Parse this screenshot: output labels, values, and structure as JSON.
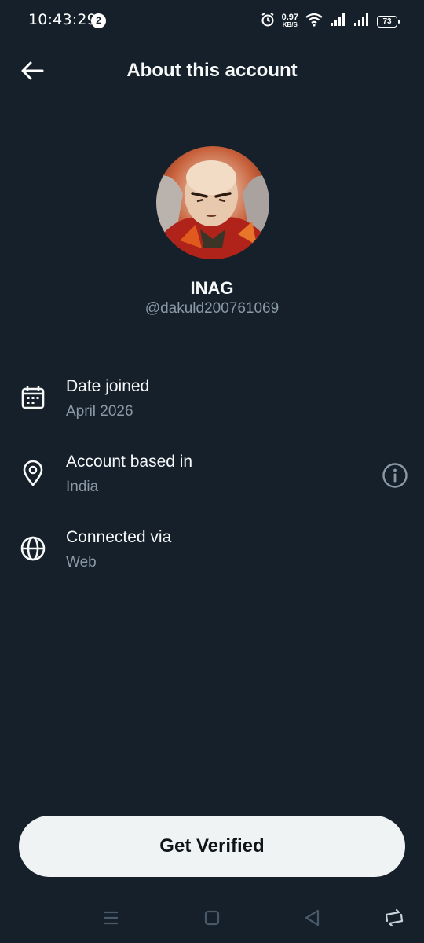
{
  "status_bar": {
    "time": "10:43:29",
    "notification_count": "2",
    "net_speed_value": "0.97",
    "net_speed_unit": "KB/S",
    "battery": "73"
  },
  "header": {
    "title": "About this account"
  },
  "profile": {
    "display_name": "INAG",
    "handle": "@dakuld200761069"
  },
  "info": {
    "date_joined": {
      "label": "Date joined",
      "value": "April 2026",
      "icon": "calendar-icon"
    },
    "account_based": {
      "label": "Account based in",
      "value": "India",
      "icon": "location-pin-icon"
    },
    "connected_via": {
      "label": "Connected via",
      "value": "Web",
      "icon": "globe-icon"
    }
  },
  "cta": {
    "label": "Get Verified"
  },
  "colors": {
    "background": "#15202b",
    "primary_text": "#f7f9f9",
    "secondary_text": "#8b98a5",
    "button_bg": "#eff3f4",
    "button_text": "#0f1419"
  }
}
